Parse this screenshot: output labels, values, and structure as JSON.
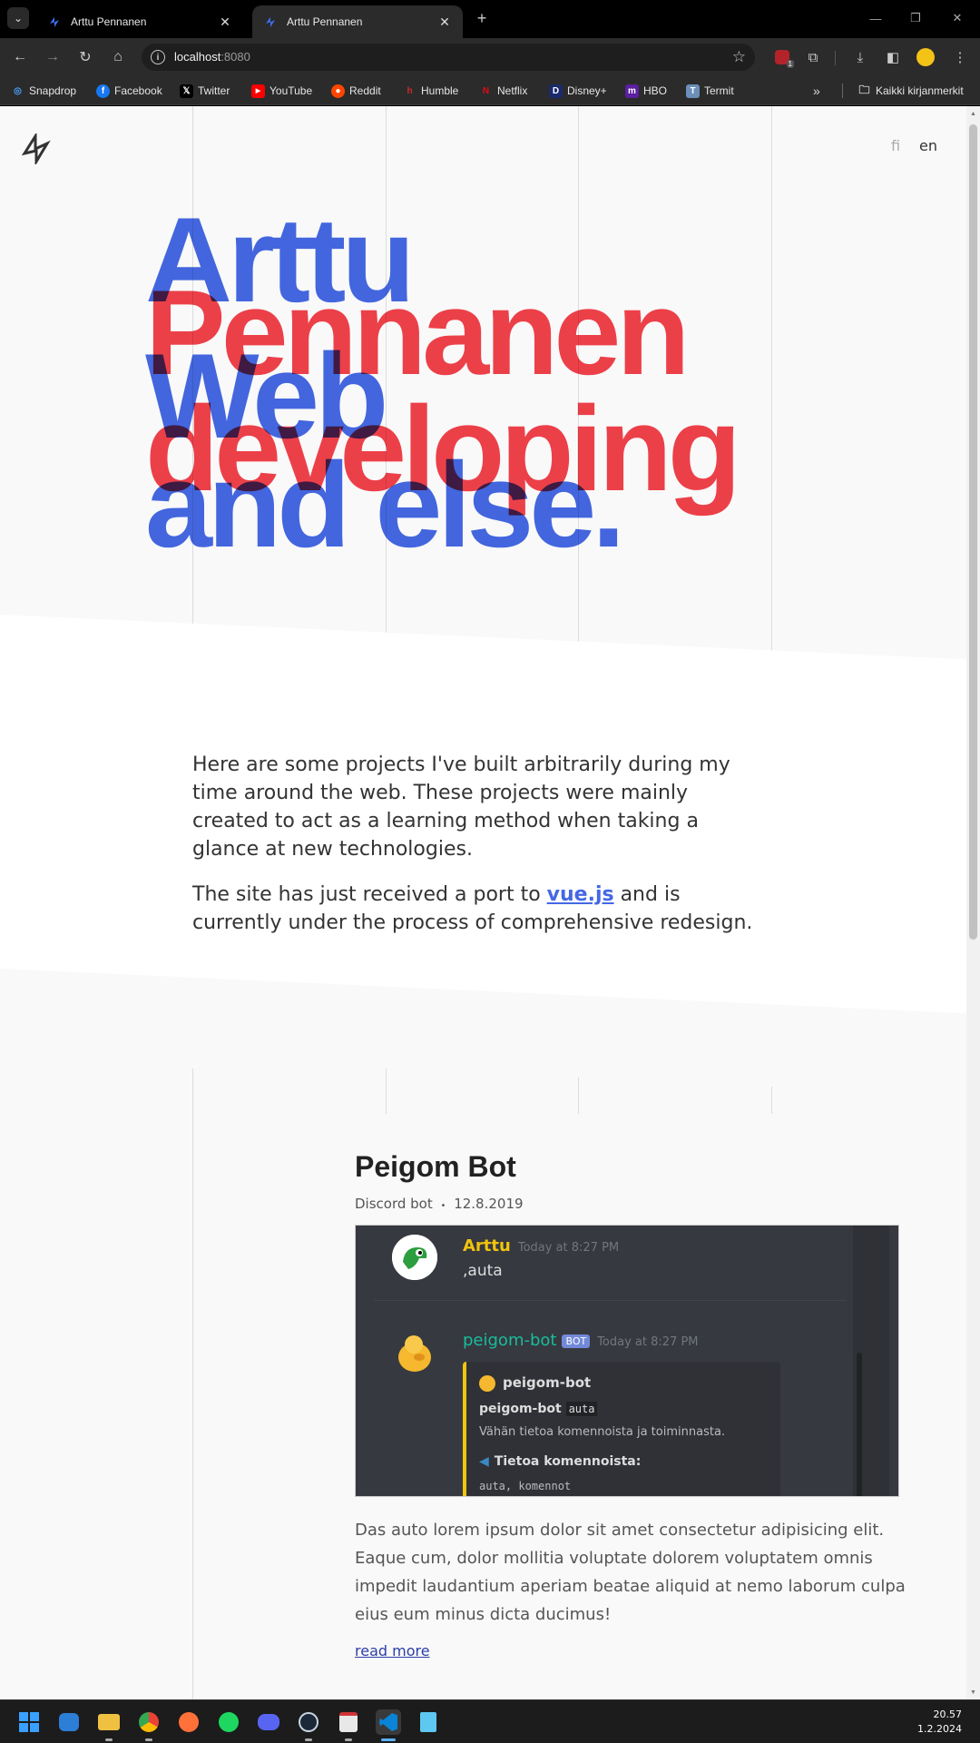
{
  "browser": {
    "tabs": [
      {
        "title": "Arttu Pennanen",
        "active": false
      },
      {
        "title": "Arttu Pennanen",
        "active": true
      }
    ],
    "url_host": "localhost",
    "url_port": ":8080",
    "bookmarks": [
      "Snapdrop",
      "Facebook",
      "Twitter",
      "YouTube",
      "Reddit",
      "Humble",
      "Netflix",
      "Disney+",
      "HBO",
      "Termit"
    ],
    "bookmarks_folder": "Kaikki kirjanmerkit",
    "extension_badge": "1"
  },
  "page": {
    "languages": {
      "fi": "fi",
      "en": "en"
    },
    "hero": {
      "line1": "Arttu",
      "line2": "Pennanen",
      "line3": "Web",
      "line4": "developing",
      "line5": "and else."
    },
    "intro": {
      "p1": "Here are some projects I've built arbitrarily during my time around the web. These projects were mainly created to act as a learning method when taking a glance at new technologies.",
      "p2_before": "The site has just received a port to ",
      "p2_link": "vue.js",
      "p2_after": " and is currently under the process of comprehensive redesign."
    },
    "project": {
      "title": "Peigom Bot",
      "category": "Discord bot",
      "separator": "•",
      "date": "12.8.2019",
      "screenshot": {
        "user1": "Arttu",
        "time1": "Today at 8:27 PM",
        "msg1": ",auta",
        "user2": "peigom-bot",
        "bot_tag": "BOT",
        "time2": "Today at 8:27 PM",
        "embed_author": "peigom-bot",
        "embed_cmd": "peigom-bot",
        "embed_cmd_arg": "auta",
        "embed_desc": "Vähän tietoa komennoista ja toiminnasta.",
        "embed_field": "Tietoa komennoista:",
        "embed_value": "auta, komennot"
      },
      "description": "Das auto lorem ipsum dolor sit amet consectetur adipisicing elit. Eaque cum, dolor mollitia voluptate dolorem voluptatem omnis impedit laudantium aperiam beatae aliquid at nemo laborum culpa eius eum minus dicta ducimus!",
      "read_more": "read more"
    }
  },
  "taskbar": {
    "time": "20.57",
    "date": "1.2.2024"
  },
  "colors": {
    "blue": "#4468e4",
    "red": "#f2414b"
  }
}
